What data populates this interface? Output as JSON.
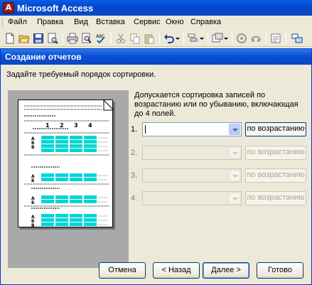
{
  "app": {
    "title": "Microsoft Access"
  },
  "menu": [
    "Файл",
    "Правка",
    "Вид",
    "Вставка",
    "Сервис",
    "Окно",
    "Справка"
  ],
  "toolbar_icons": [
    "new-icon",
    "open-icon",
    "save-icon",
    "search-icon",
    "print-icon",
    "print-preview-icon",
    "spelling-icon",
    "cut-icon",
    "copy-icon",
    "paste-icon",
    "undo-icon",
    "analyze-icon",
    "office-links-icon",
    "code-icon",
    "relationships-icon",
    "new-object-icon"
  ],
  "dialog": {
    "title": "Создание отчетов",
    "instruction": "Задайте требуемый порядок сортировки.",
    "description": "Допускается сортировка записей по возрастанию или по убыванию, включающая до 4 полей.",
    "sort_rows": [
      {
        "number": "1.",
        "value": "",
        "order": "по возрастанию",
        "enabled": true
      },
      {
        "number": "2.",
        "value": "",
        "order": "по возрастанию",
        "enabled": false
      },
      {
        "number": "3.",
        "value": "",
        "order": "по возрастанию",
        "enabled": false
      },
      {
        "number": "4.",
        "value": "",
        "order": "по возрастанию",
        "enabled": false
      }
    ],
    "preview": {
      "column_numbers": [
        "1",
        "2",
        "3",
        "4"
      ],
      "row_letters": [
        "A",
        "Б",
        "В"
      ]
    },
    "buttons": {
      "cancel": "Отмена",
      "back": "< Назад",
      "next": "Далее >",
      "finish": "Готово"
    }
  },
  "colors": {
    "title_bar": "#0a4fd6",
    "preview_bg": "#a9a9a9",
    "preview_cells": "#00d5d5"
  }
}
